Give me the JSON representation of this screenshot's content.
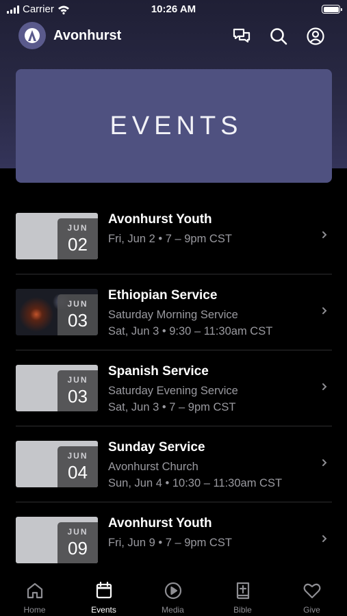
{
  "status_bar": {
    "carrier": "Carrier",
    "time": "10:26 AM"
  },
  "header": {
    "app_name": "Avonhurst",
    "icons": [
      "chat-icon",
      "search-icon",
      "profile-icon"
    ]
  },
  "hero": {
    "title": "EVENTS"
  },
  "events": [
    {
      "month": "JUN",
      "day": "02",
      "title": "Avonhurst Youth",
      "subtitle": "",
      "datetime": "Fri, Jun 2 • 7 – 9pm CST",
      "thumb": "plain"
    },
    {
      "month": "JUN",
      "day": "03",
      "title": "Ethiopian Service",
      "subtitle": "Saturday Morning Service",
      "datetime": "Sat, Jun 3 • 9:30 – 11:30am CST",
      "thumb": "photo"
    },
    {
      "month": "JUN",
      "day": "03",
      "title": "Spanish Service",
      "subtitle": "Saturday Evening Service",
      "datetime": "Sat, Jun 3 • 7 – 9pm CST",
      "thumb": "plain"
    },
    {
      "month": "JUN",
      "day": "04",
      "title": "Sunday Service",
      "subtitle": "Avonhurst Church",
      "datetime": "Sun, Jun 4 • 10:30 – 11:30am CST",
      "thumb": "plain"
    },
    {
      "month": "JUN",
      "day": "09",
      "title": "Avonhurst Youth",
      "subtitle": "",
      "datetime": "Fri, Jun 9 • 7 – 9pm CST",
      "thumb": "plain"
    }
  ],
  "tabs": [
    {
      "label": "Home",
      "icon": "home-icon",
      "active": false
    },
    {
      "label": "Events",
      "icon": "calendar-icon",
      "active": true
    },
    {
      "label": "Media",
      "icon": "play-icon",
      "active": false
    },
    {
      "label": "Bible",
      "icon": "bible-icon",
      "active": false
    },
    {
      "label": "Give",
      "icon": "heart-icon",
      "active": false
    }
  ],
  "colors": {
    "hero": "#4f5180",
    "header_bg": "#2a2a46",
    "inactive_tab": "#8e8e93",
    "subtitle": "#9a9aa0"
  }
}
